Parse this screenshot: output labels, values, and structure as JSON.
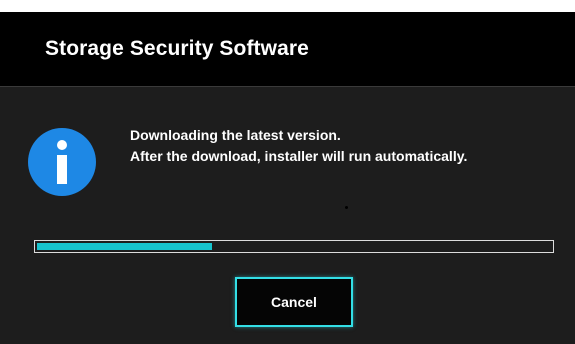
{
  "window": {
    "title": "Storage Security Software"
  },
  "message": {
    "line1": "Downloading the latest version.",
    "line2": "After the download, installer will run automatically."
  },
  "icon": {
    "name": "info-icon",
    "color": "#1e88e5"
  },
  "progress": {
    "fraction": 0.34,
    "color": "#17c3cd"
  },
  "buttons": {
    "cancel_label": "Cancel"
  },
  "colors": {
    "accent": "#33dfe6",
    "background": "#1d1d1d",
    "titlebar": "#000000"
  }
}
